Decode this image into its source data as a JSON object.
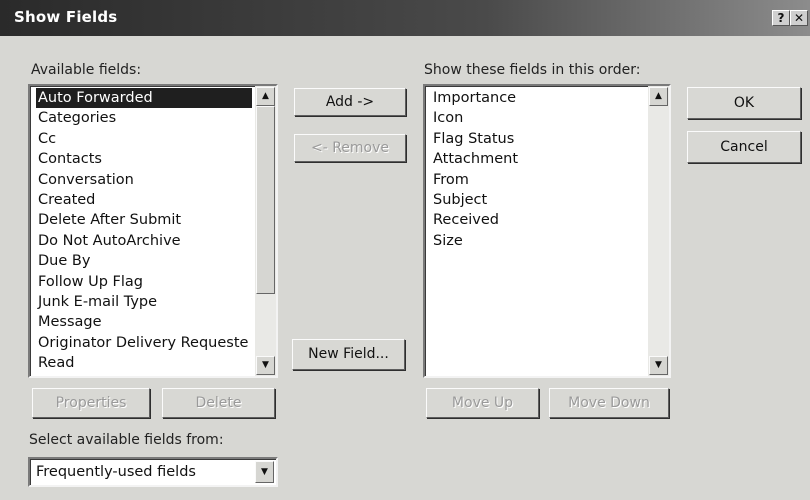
{
  "window": {
    "title": "Show Fields",
    "help_glyph": "?",
    "close_glyph": "✕"
  },
  "available": {
    "label": "Available fields:",
    "items": [
      "Auto Forwarded",
      "Categories",
      "Cc",
      "Contacts",
      "Conversation",
      "Created",
      "Delete After Submit",
      "Do Not AutoArchive",
      "Due By",
      "Follow Up Flag",
      "Junk E-mail Type",
      "Message",
      "Originator Delivery Requeste",
      "Read"
    ],
    "selected_index": 0
  },
  "order": {
    "label": "Show these fields in this order:",
    "items": [
      "Importance",
      "Icon",
      "Flag Status",
      "Attachment",
      "From",
      "Subject",
      "Received",
      "Size"
    ]
  },
  "buttons": {
    "add": "Add ->",
    "remove": "<- Remove",
    "new_field": "New Field...",
    "ok": "OK",
    "cancel": "Cancel",
    "properties": "Properties",
    "delete": "Delete",
    "move_up": "Move Up",
    "move_down": "Move Down"
  },
  "source": {
    "label": "Select available fields from:",
    "value": "Frequently-used fields"
  },
  "icons": {
    "scroll_up": "▲",
    "scroll_down": "▼",
    "dropdown": "▼"
  },
  "colors": {
    "titlebar": "#2a2a2a",
    "dialog_bg": "#d7d7d3",
    "selection": "#1f1f1f"
  }
}
